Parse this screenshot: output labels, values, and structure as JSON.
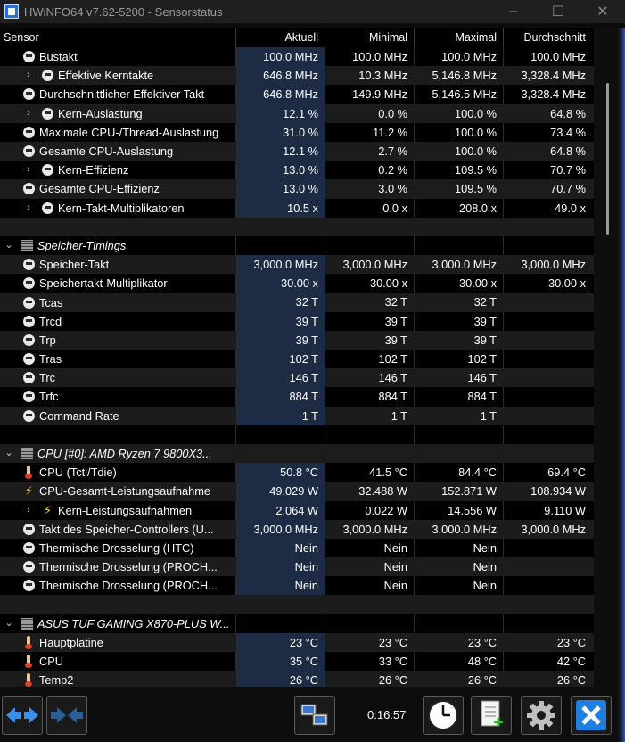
{
  "window": {
    "title": "HWiNFO64 v7.62-5200 - Sensorstatus",
    "minimize": "–",
    "maximize": "☐",
    "close": "✕"
  },
  "columns": [
    "Sensor",
    "Aktuell",
    "Minimal",
    "Maximal",
    "Durchschnitt"
  ],
  "rows": [
    {
      "kind": "sensor",
      "indent": 0,
      "expand": "",
      "icon": "gauge-icon",
      "name": "Bustakt",
      "v": [
        "100.0 MHz",
        "100.0 MHz",
        "100.0 MHz",
        "100.0 MHz"
      ]
    },
    {
      "kind": "sensor",
      "indent": 1,
      "expand": "›",
      "icon": "gauge-icon",
      "name": "Effektive Kerntakte",
      "v": [
        "646.8 MHz",
        "10.3 MHz",
        "5,146.8 MHz",
        "3,328.4 MHz"
      ]
    },
    {
      "kind": "sensor",
      "indent": 0,
      "expand": "",
      "icon": "gauge-icon",
      "name": "Durchschnittlicher Effektiver Takt",
      "v": [
        "646.8 MHz",
        "149.9 MHz",
        "5,146.5 MHz",
        "3,328.4 MHz"
      ]
    },
    {
      "kind": "sensor",
      "indent": 1,
      "expand": "›",
      "icon": "gauge-icon",
      "name": "Kern-Auslastung",
      "v": [
        "12.1 %",
        "0.0 %",
        "100.0 %",
        "64.8 %"
      ]
    },
    {
      "kind": "sensor",
      "indent": 0,
      "expand": "",
      "icon": "gauge-icon",
      "name": "Maximale CPU-/Thread-Auslastung",
      "v": [
        "31.0 %",
        "11.2 %",
        "100.0 %",
        "73.4 %"
      ]
    },
    {
      "kind": "sensor",
      "indent": 0,
      "expand": "",
      "icon": "gauge-icon",
      "name": "Gesamte CPU-Auslastung",
      "v": [
        "12.1 %",
        "2.7 %",
        "100.0 %",
        "64.8 %"
      ]
    },
    {
      "kind": "sensor",
      "indent": 1,
      "expand": "›",
      "icon": "gauge-icon",
      "name": "Kern-Effizienz",
      "v": [
        "13.0 %",
        "0.2 %",
        "109.5 %",
        "70.7 %"
      ]
    },
    {
      "kind": "sensor",
      "indent": 0,
      "expand": "",
      "icon": "gauge-icon",
      "name": "Gesamte CPU-Effizienz",
      "v": [
        "13.0 %",
        "3.0 %",
        "109.5 %",
        "70.7 %"
      ]
    },
    {
      "kind": "sensor",
      "indent": 1,
      "expand": "›",
      "icon": "gauge-icon",
      "name": "Kern-Takt-Multiplikatoren",
      "v": [
        "10.5 x",
        "0.0 x",
        "208.0 x",
        "49.0 x"
      ]
    },
    {
      "kind": "blank"
    },
    {
      "kind": "group",
      "name": "Speicher-Timings"
    },
    {
      "kind": "sensor",
      "indent": 0,
      "expand": "",
      "icon": "gauge-icon",
      "name": "Speicher-Takt",
      "v": [
        "3,000.0 MHz",
        "3,000.0 MHz",
        "3,000.0 MHz",
        "3,000.0 MHz"
      ]
    },
    {
      "kind": "sensor",
      "indent": 0,
      "expand": "",
      "icon": "gauge-icon",
      "name": "Speichertakt-Multiplikator",
      "v": [
        "30.00 x",
        "30.00 x",
        "30.00 x",
        "30.00 x"
      ]
    },
    {
      "kind": "sensor",
      "indent": 0,
      "expand": "",
      "icon": "gauge-icon",
      "name": "Tcas",
      "v": [
        "32 T",
        "32 T",
        "32 T",
        ""
      ]
    },
    {
      "kind": "sensor",
      "indent": 0,
      "expand": "",
      "icon": "gauge-icon",
      "name": "Trcd",
      "v": [
        "39 T",
        "39 T",
        "39 T",
        ""
      ]
    },
    {
      "kind": "sensor",
      "indent": 0,
      "expand": "",
      "icon": "gauge-icon",
      "name": "Trp",
      "v": [
        "39 T",
        "39 T",
        "39 T",
        ""
      ]
    },
    {
      "kind": "sensor",
      "indent": 0,
      "expand": "",
      "icon": "gauge-icon",
      "name": "Tras",
      "v": [
        "102 T",
        "102 T",
        "102 T",
        ""
      ]
    },
    {
      "kind": "sensor",
      "indent": 0,
      "expand": "",
      "icon": "gauge-icon",
      "name": "Trc",
      "v": [
        "146 T",
        "146 T",
        "146 T",
        ""
      ]
    },
    {
      "kind": "sensor",
      "indent": 0,
      "expand": "",
      "icon": "gauge-icon",
      "name": "Trfc",
      "v": [
        "884 T",
        "884 T",
        "884 T",
        ""
      ]
    },
    {
      "kind": "sensor",
      "indent": 0,
      "expand": "",
      "icon": "gauge-icon",
      "name": "Command Rate",
      "v": [
        "1 T",
        "1 T",
        "1 T",
        ""
      ]
    },
    {
      "kind": "blank"
    },
    {
      "kind": "group",
      "name": "CPU [#0]: AMD Ryzen 7 9800X3..."
    },
    {
      "kind": "sensor",
      "indent": 0,
      "expand": "",
      "icon": "thermometer-icon",
      "name": "CPU (Tctl/Tdie)",
      "v": [
        "50.8 °C",
        "41.5 °C",
        "84.4 °C",
        "69.4 °C"
      ]
    },
    {
      "kind": "sensor",
      "indent": 0,
      "expand": "",
      "icon": "lightning-icon",
      "name": "CPU-Gesamt-Leistungsaufnahme",
      "v": [
        "49.029 W",
        "32.488 W",
        "152.871 W",
        "108.934 W"
      ]
    },
    {
      "kind": "sensor",
      "indent": 1,
      "expand": "›",
      "icon": "lightning-icon",
      "name": "Kern-Leistungsaufnahmen",
      "v": [
        "2.064 W",
        "0.022 W",
        "14.556 W",
        "9.110 W"
      ]
    },
    {
      "kind": "sensor",
      "indent": 0,
      "expand": "",
      "icon": "gauge-icon",
      "name": "Takt des Speicher-Controllers (U...",
      "v": [
        "3,000.0 MHz",
        "3,000.0 MHz",
        "3,000.0 MHz",
        "3,000.0 MHz"
      ]
    },
    {
      "kind": "sensor",
      "indent": 0,
      "expand": "",
      "icon": "gauge-icon",
      "name": "Thermische Drosselung (HTC)",
      "v": [
        "Nein",
        "Nein",
        "Nein",
        ""
      ]
    },
    {
      "kind": "sensor",
      "indent": 0,
      "expand": "",
      "icon": "gauge-icon",
      "name": "Thermische Drosselung (PROCH...",
      "v": [
        "Nein",
        "Nein",
        "Nein",
        ""
      ]
    },
    {
      "kind": "sensor",
      "indent": 0,
      "expand": "",
      "icon": "gauge-icon",
      "name": "Thermische Drosselung (PROCH...",
      "v": [
        "Nein",
        "Nein",
        "Nein",
        ""
      ]
    },
    {
      "kind": "blank"
    },
    {
      "kind": "group",
      "name": "ASUS TUF GAMING X870-PLUS W..."
    },
    {
      "kind": "sensor",
      "indent": 0,
      "expand": "",
      "icon": "thermometer-icon",
      "name": "Hauptplatine",
      "v": [
        "23 °C",
        "23 °C",
        "23 °C",
        "23 °C"
      ]
    },
    {
      "kind": "sensor",
      "indent": 0,
      "expand": "",
      "icon": "thermometer-icon",
      "name": "CPU",
      "v": [
        "35 °C",
        "33 °C",
        "48 °C",
        "42 °C"
      ]
    },
    {
      "kind": "sensor",
      "indent": 0,
      "expand": "",
      "icon": "thermometer-icon",
      "name": "Temp2",
      "v": [
        "26 °C",
        "26 °C",
        "26 °C",
        "26 °C"
      ]
    }
  ],
  "toolbar": {
    "timer": "0:16:57",
    "buttons": [
      "expand-arrows-icon",
      "collapse-arrows-icon",
      "network-icon",
      "clock-icon",
      "report-icon",
      "settings-gear-icon",
      "close-x-icon"
    ]
  }
}
